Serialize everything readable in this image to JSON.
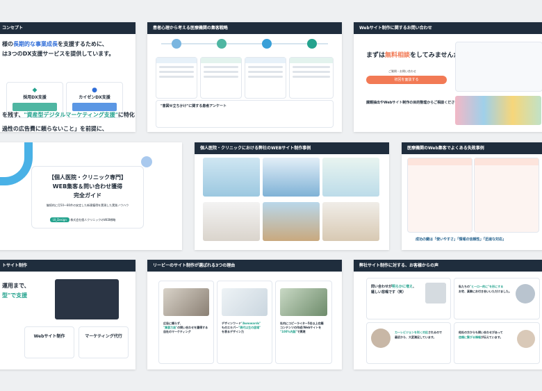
{
  "slides": {
    "s1": {
      "title": "コンセプト",
      "line1": "様の長期的な事業成長を支援するために、",
      "line1_hl": "長期的な事業成長",
      "line2": "は3つのDX支援サービスを提供しています。",
      "card1": "採用DX支援",
      "card2": "カイゼンDX支援",
      "bottom1": "過性の広告費に頼らないこと」を前提に、",
      "bottom2": "を残す、",
      "bottom_hl": "\"資産型デジタルマーケティング支援\"",
      "bottom3": "に特化"
    },
    "s2": {
      "title": "患者心理から考える医療機関の集客戦略",
      "footer_label": "\"意図せ立ちかけ\"に関する患者アンケート"
    },
    "s3": {
      "title": "Webサイト制作に関するお問い合わせ",
      "q1": "まずは",
      "q_hl": "無料相談",
      "q2": "をしてみませんか？",
      "btn1": "ご質問・お問い合わせ",
      "btn2": "初回を面談する",
      "sub": "課題抽出やWebサイト制作の目的整理からご相談ください"
    },
    "s4": {
      "title1": "【個人医院・クリニック専門】",
      "title2": "WEB集客＆問い合わせ獲得",
      "title3": "完全ガイド",
      "sub": "継続的に月50〜80件の安定した新患獲得を実現した実践ノウハウ",
      "tag": "UI_Design",
      "company": "株式会社個人クリニックのWEB戦略"
    },
    "s5": {
      "title": "個人医院・クリニックにおける弊社のWEBサイト制作事例"
    },
    "s6": {
      "title": "医療機関のWeb集客でよくある失敗事例",
      "footer": "成功の鍵は「使いやすさ」「情報の信頼性」「迅速な対応」"
    },
    "s7": {
      "title": "トサイト制作",
      "l1": "運用まで、",
      "l2_hl": "型\"で支援",
      "c1": "Webサイト制作",
      "c2": "マーケティング代行"
    },
    "s8": {
      "title": "リービーのサイト制作が選ばれる3つの理由",
      "t1a": "広告に頼らず、",
      "t1_hl": "\"集客力抜\"",
      "t1b": "の問い合わせを獲得する",
      "t1c": "自社のマーケティング",
      "t2a": "デザインワード",
      "t2_hl": "\"Awwwards\"",
      "t2b": "ものエキパー",
      "t2c": "\"現代は生の居場\"",
      "t2d": "を表るデザイン力",
      "t3a": "社内にコピーライター5名以上在籍",
      "t3b": "コンテンツの作成/Webサイトを",
      "t3_hl": "\"100%内製\"",
      "t3c": "で実現"
    },
    "s9": {
      "title": "弊社サイト制作に対する、お客様からの声",
      "q1a": "問い合わせが",
      "q1_hl": "明らかに増え",
      "q1b": "、",
      "q1c": "嬉しい悲鳴です（笑）",
      "q2a": "私たちの",
      "q2_hl": "\"ヒーロー的に\"を形にする",
      "q2b": "",
      "q2c": "お宅、真摯にお付き合いいただけました。",
      "q3a": "カーレビジョンを利く対応",
      "q3b": "されるので",
      "q3c": "最初から、大変満足しています。",
      "q4a": "他社の方からも問い合わせがあって",
      "q4_hl": "信頼に繋がる情報",
      "q4b": "が伝えています。"
    }
  },
  "colors": {
    "navy": "#1f2d3d",
    "teal": "#25a38e",
    "blue": "#2f6dd8",
    "orange": "#f27a55",
    "sky": "#3aa0d8"
  }
}
